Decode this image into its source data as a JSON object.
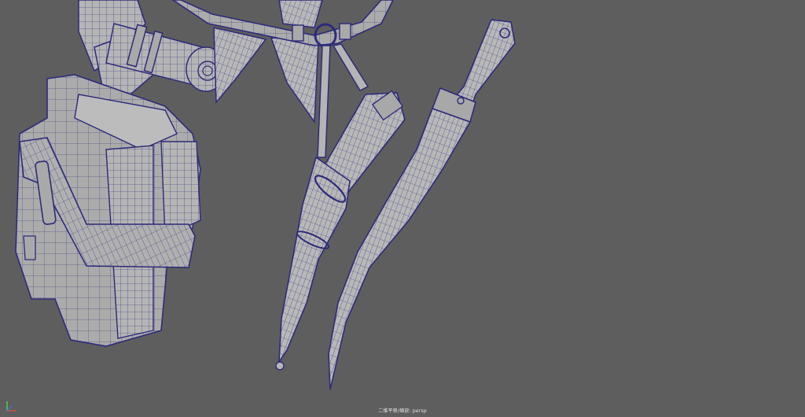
{
  "viewport": {
    "camera_label": "二维平移/缩放: persp",
    "background_color": "#5e5e5e",
    "wire_color": "#2d2b7a",
    "surface_color": "#b6b6b6"
  },
  "axis_gizmo": {
    "x_color": "#d24a3a",
    "y_color": "#4ccf4c",
    "z_color": "#4a6adf"
  }
}
